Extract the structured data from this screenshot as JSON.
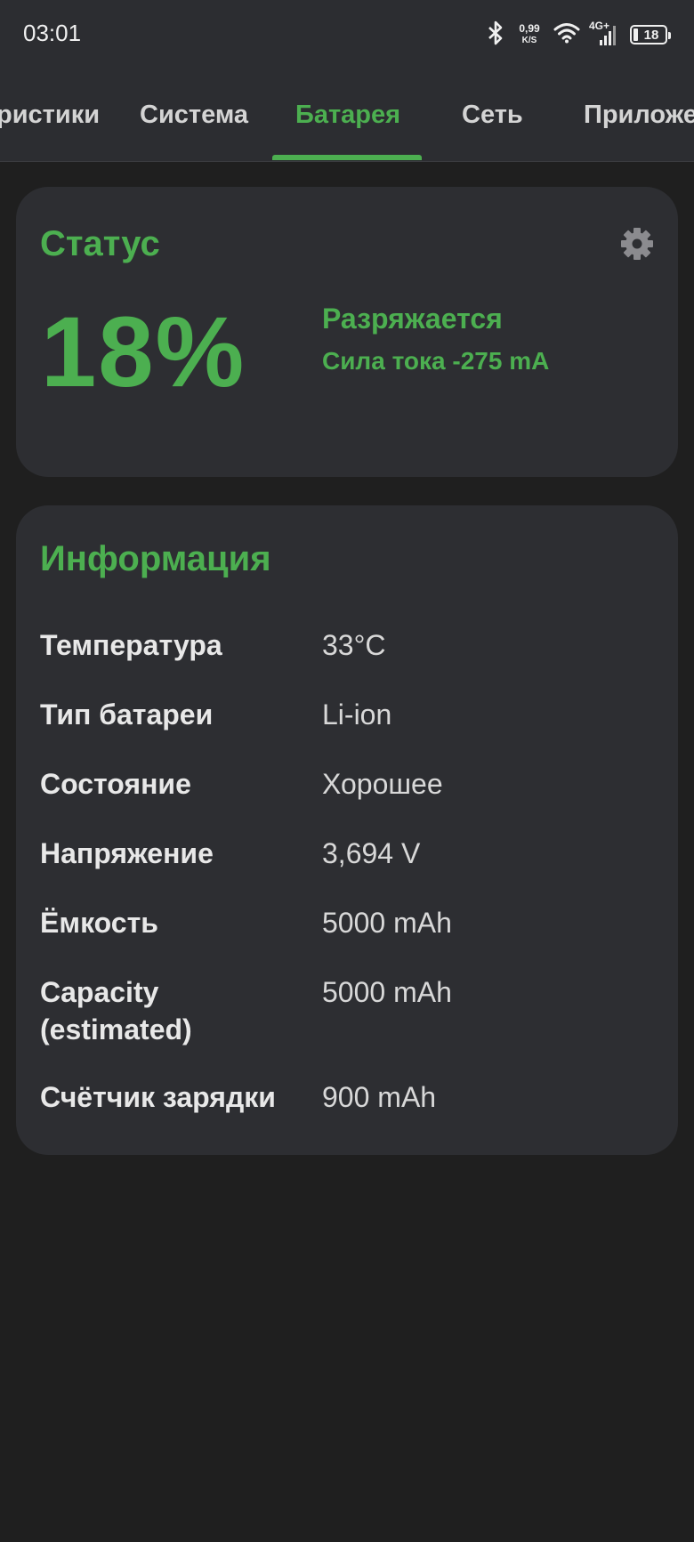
{
  "status_bar": {
    "time": "03:01",
    "net_speed_value": "0,99",
    "net_speed_unit": "K/S",
    "network_type": "4G+",
    "battery_level": "18",
    "icons": [
      "bluetooth-icon",
      "wifi-icon",
      "signal-icon",
      "battery-icon"
    ]
  },
  "tabs": [
    {
      "label": "ристики"
    },
    {
      "label": "Система"
    },
    {
      "label": "Батарея",
      "active": true
    },
    {
      "label": "Сеть"
    },
    {
      "label": "Приложе"
    }
  ],
  "status_card": {
    "title": "Статус",
    "percent": "18%",
    "state": "Разряжается",
    "current": "Сила тока -275 mA"
  },
  "info_card": {
    "title": "Информация",
    "rows": [
      {
        "key": "Температура",
        "value": "33°C"
      },
      {
        "key": "Тип батареи",
        "value": "Li-ion"
      },
      {
        "key": "Состояние",
        "value": "Хорошее"
      },
      {
        "key": "Напряжение",
        "value": "3,694 V"
      },
      {
        "key": "Ёмкость",
        "value": "5000 mAh"
      },
      {
        "key": "Capacity (estimated)",
        "value": "5000 mAh"
      },
      {
        "key": "Счётчик зарядки",
        "value": "900 mAh"
      }
    ]
  },
  "colors": {
    "accent": "#4caf50",
    "background": "#1f1f1f",
    "card": "#2d2e32",
    "appbar": "#2c2d31"
  }
}
